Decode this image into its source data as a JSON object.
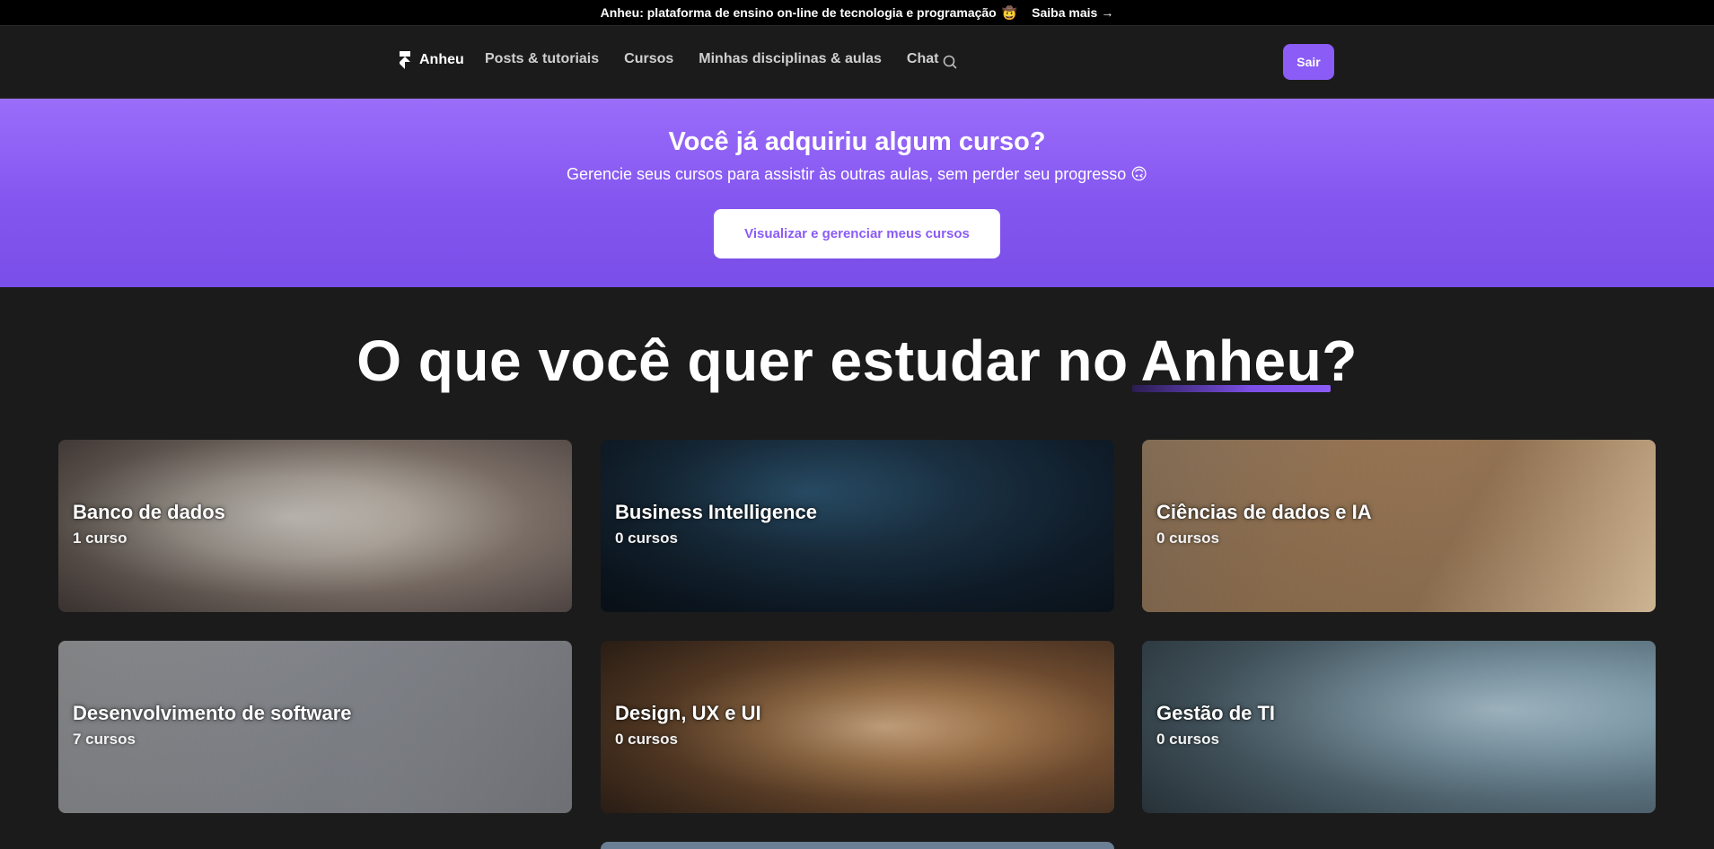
{
  "announcement": {
    "text": "Anheu: plataforma de ensino on-line de tecnologia e programação",
    "emoji": "🤠",
    "link_label": "Saiba mais",
    "link_arrow": "→"
  },
  "navbar": {
    "brand": "Anheu",
    "links": [
      "Posts & tutoriais",
      "Cursos",
      "Minhas disciplinas & aulas",
      "Chat"
    ],
    "logout_label": "Sair"
  },
  "banner": {
    "title": "Você já adquiriu algum curso?",
    "subtitle": "Gerencie seus cursos para assistir às outras aulas, sem perder seu progresso 🙃",
    "cta_label": "Visualizar e gerenciar meus cursos"
  },
  "headline": {
    "prefix": "O que você quer estudar no",
    "brand_word": "Anheu",
    "suffix": "?"
  },
  "categories": [
    {
      "title": "Banco de dados",
      "count": "1 curso"
    },
    {
      "title": "Business Intelligence",
      "count": "0 cursos"
    },
    {
      "title": "Ciências de dados e IA",
      "count": "0 cursos"
    },
    {
      "title": "Desenvolvimento de software",
      "count": "7 cursos"
    },
    {
      "title": "Design, UX e UI",
      "count": "0 cursos"
    },
    {
      "title": "Gestão de TI",
      "count": "0 cursos"
    }
  ],
  "colors": {
    "accent": "#8b5cf6",
    "background": "#1b1b1b",
    "announcement_bg": "#000000"
  }
}
